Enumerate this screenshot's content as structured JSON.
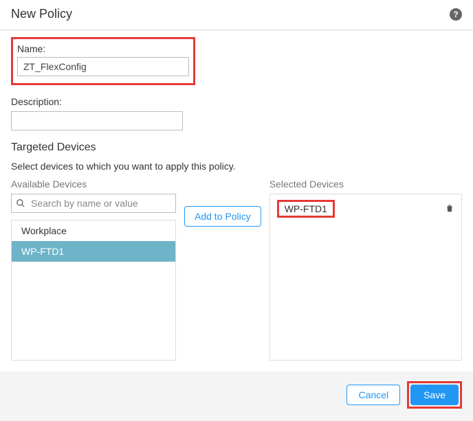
{
  "header": {
    "title": "New Policy"
  },
  "fields": {
    "name_label": "Name:",
    "name_value": "ZT_FlexConfig",
    "description_label": "Description:",
    "description_value": ""
  },
  "targeted": {
    "title": "Targeted Devices",
    "instructions": "Select devices to which you want to apply this policy.",
    "available_label": "Available Devices",
    "selected_label": "Selected Devices",
    "search_placeholder": "Search by name or value",
    "add_button": "Add to Policy",
    "available_items": {
      "0": {
        "label": "Workplace"
      },
      "1": {
        "label": "WP-FTD1"
      }
    },
    "selected_items": {
      "0": {
        "label": "WP-FTD1"
      }
    }
  },
  "footer": {
    "cancel": "Cancel",
    "save": "Save"
  }
}
